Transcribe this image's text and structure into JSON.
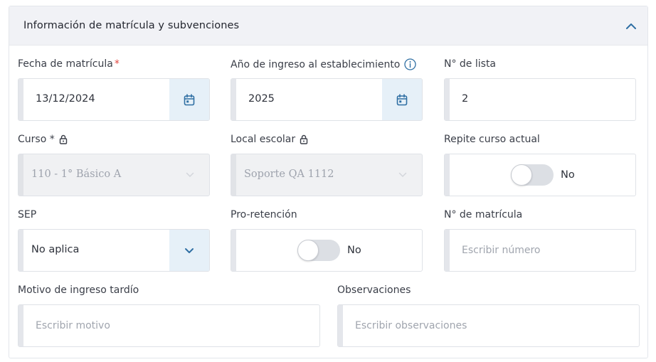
{
  "panel": {
    "title": "Información de matrícula y subvenciones"
  },
  "fields": {
    "fecha_matricula": {
      "label": "Fecha de matrícula",
      "required_mark": "*",
      "value": "13/12/2024"
    },
    "anio_ingreso": {
      "label": "Año de ingreso al establecimiento",
      "value": "2025"
    },
    "num_lista": {
      "label": "N° de lista",
      "value": "2"
    },
    "curso": {
      "label": "Curso *",
      "value": "110 - 1° Básico A"
    },
    "local_escolar": {
      "label": "Local escolar",
      "value": "Soporte QA 1112"
    },
    "repite_curso": {
      "label": "Repite curso actual",
      "toggle_text": "No"
    },
    "sep": {
      "label": "SEP",
      "value": "No aplica"
    },
    "pro_retencion": {
      "label": "Pro-retención",
      "toggle_text": "No"
    },
    "num_matricula": {
      "label": "N° de matrícula",
      "placeholder": "Escribir número"
    },
    "motivo_ingreso": {
      "label": "Motivo de ingreso tardío",
      "placeholder": "Escribir motivo"
    },
    "observaciones": {
      "label": "Observaciones",
      "placeholder": "Escribir observaciones"
    }
  },
  "colors": {
    "accent": "#2f6fa3",
    "required": "#e2463f",
    "addon_bg": "#e6f0f8"
  },
  "icons": {
    "collapse": "chevron-up-icon",
    "calendar": "calendar-icon",
    "info": "info-icon",
    "lock": "lock-icon",
    "dropdown": "chevron-down-icon"
  }
}
